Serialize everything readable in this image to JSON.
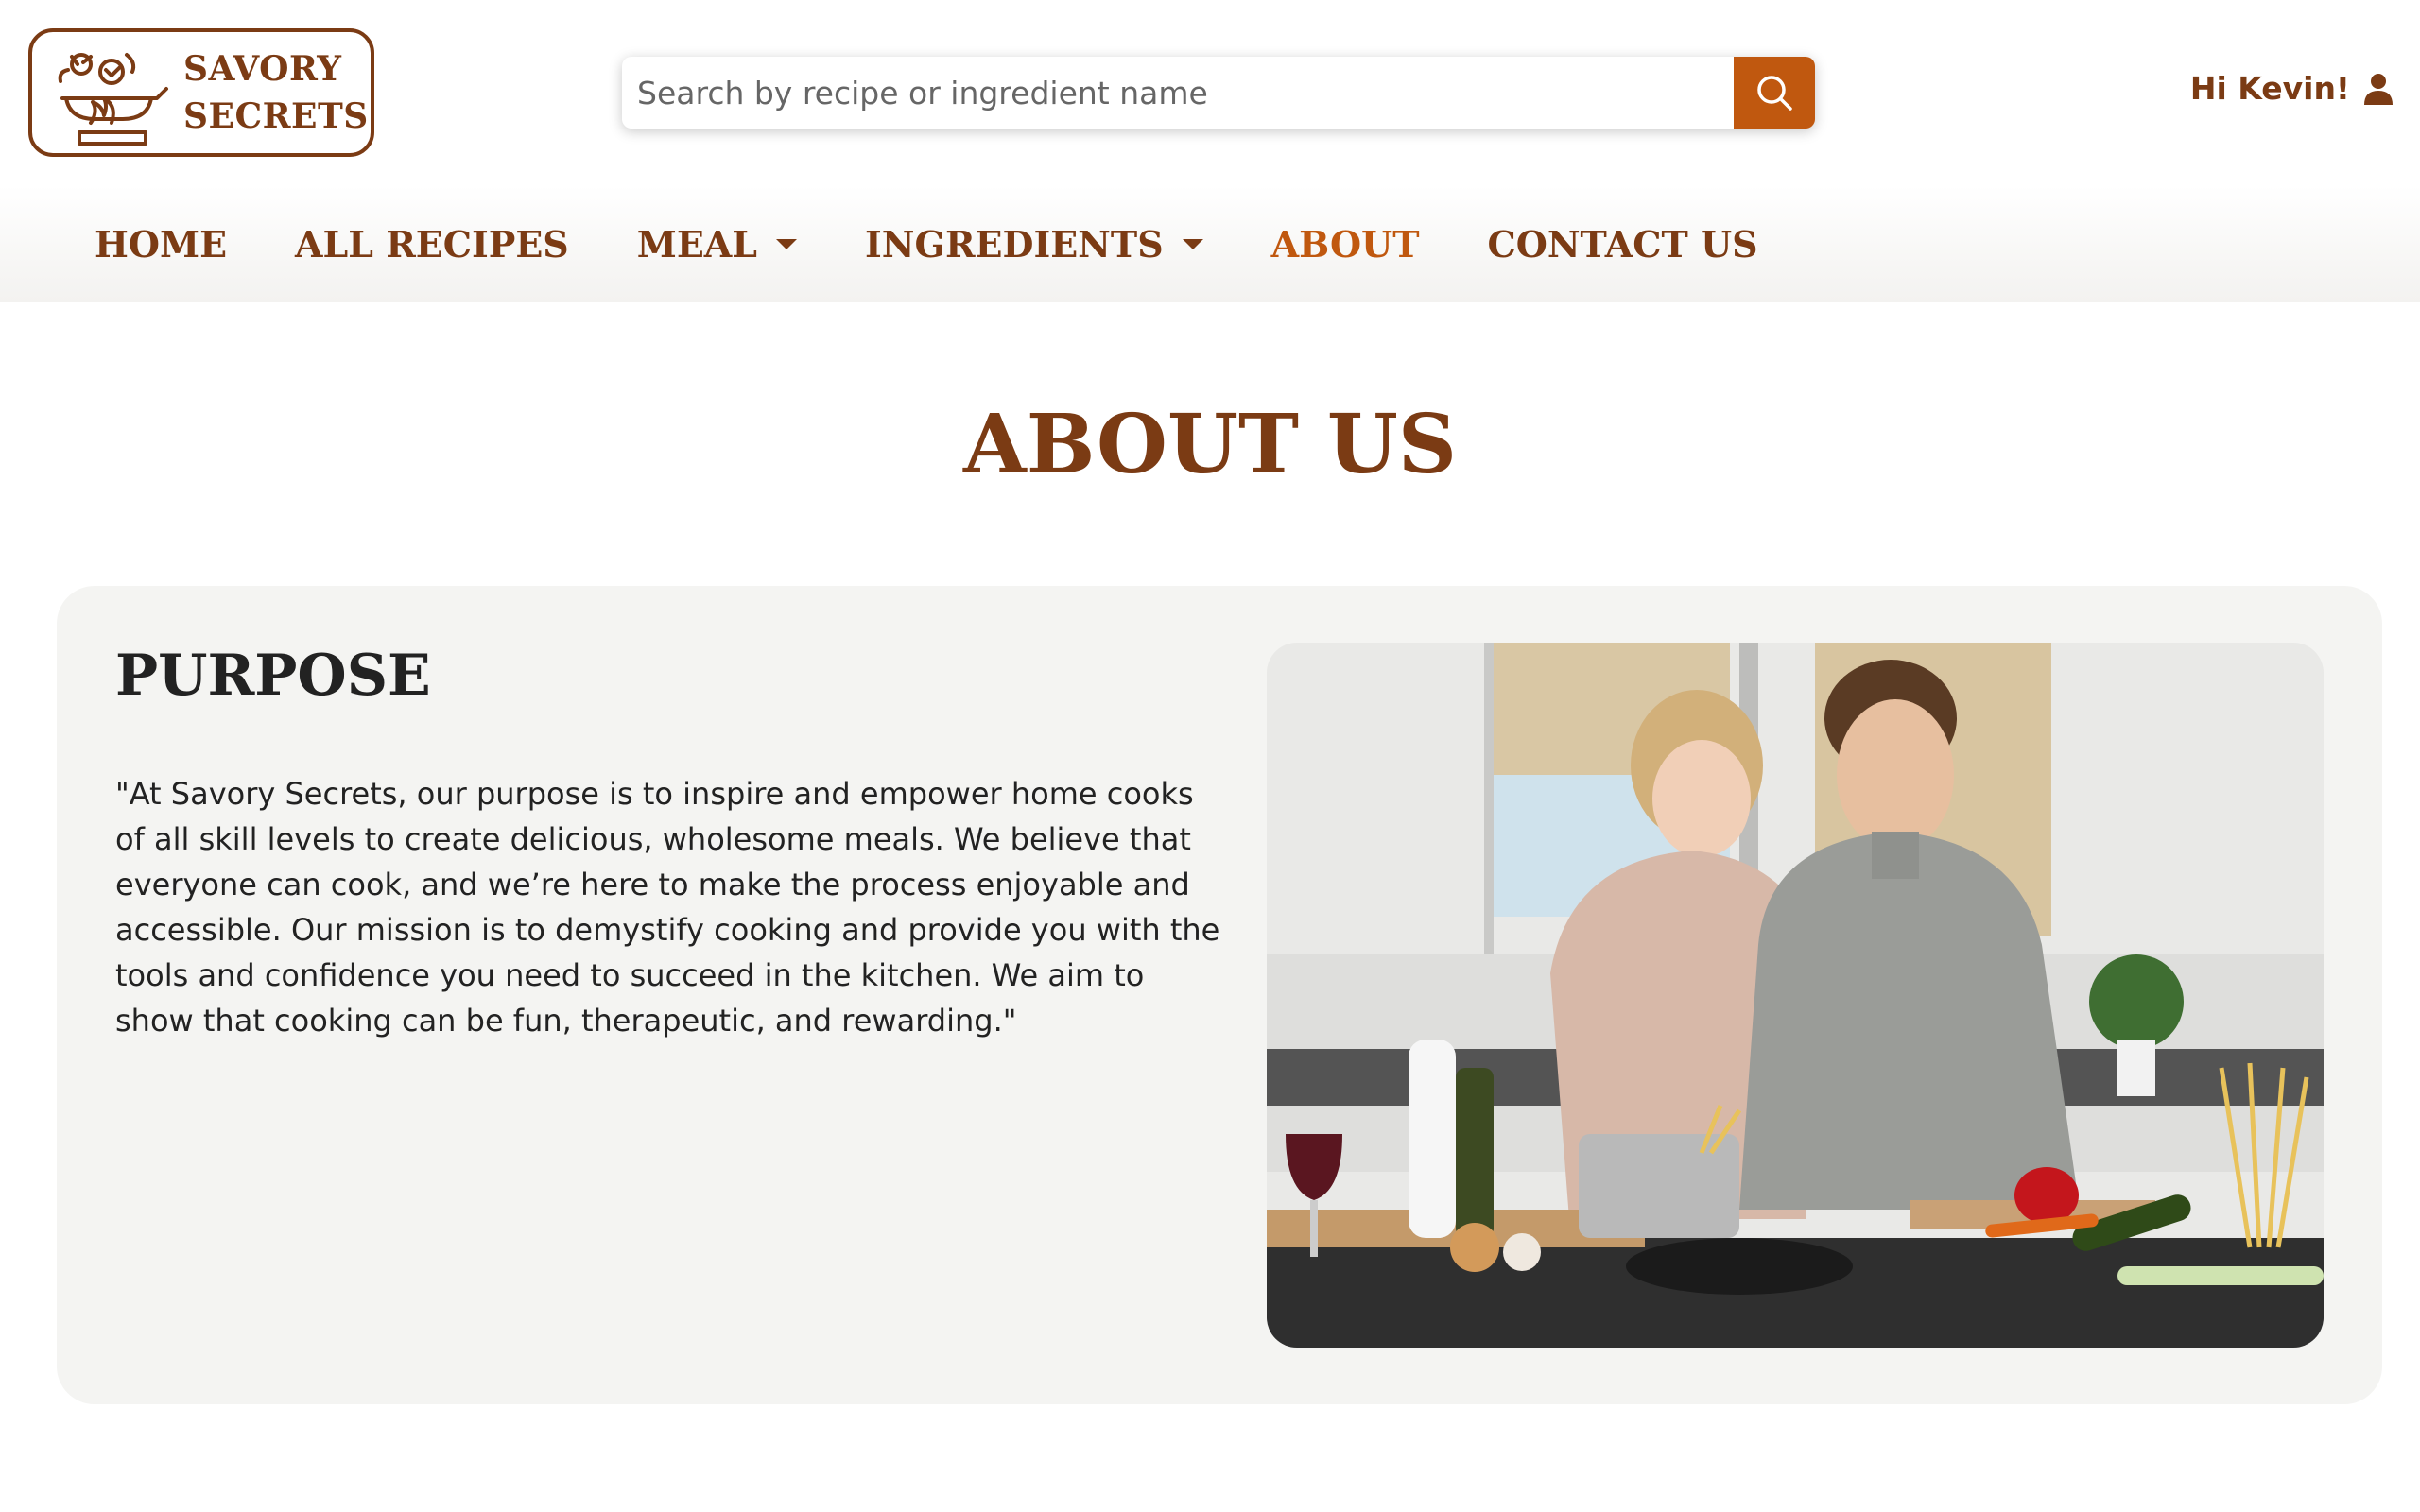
{
  "brand": {
    "line1": "SAVORY",
    "line2": "SECRETS"
  },
  "search": {
    "placeholder": "Search by recipe or ingredient name"
  },
  "user": {
    "greeting": "Hi Kevin!"
  },
  "nav": {
    "home": "HOME",
    "all_recipes": "ALL RECIPES",
    "meal": "MEAL",
    "ingredients": "INGREDIENTS",
    "about": "ABOUT",
    "contact": "CONTACT US"
  },
  "page": {
    "title": "ABOUT US"
  },
  "purpose": {
    "heading": "PURPOSE",
    "body": "\"At Savory Secrets, our purpose is to inspire and empower home cooks of all skill levels to create delicious, wholesome meals. We believe that everyone can cook, and we’re here to make the process enjoyable and accessible. Our mission is to demystify cooking and provide you with the tools and confidence you need to succeed in the kitchen. We aim to show that cooking can be fun, therapeutic, and rewarding.\""
  },
  "colors": {
    "brand_brown": "#7b3b14",
    "accent_orange": "#c0580f",
    "card_bg": "#f4f4f2"
  }
}
